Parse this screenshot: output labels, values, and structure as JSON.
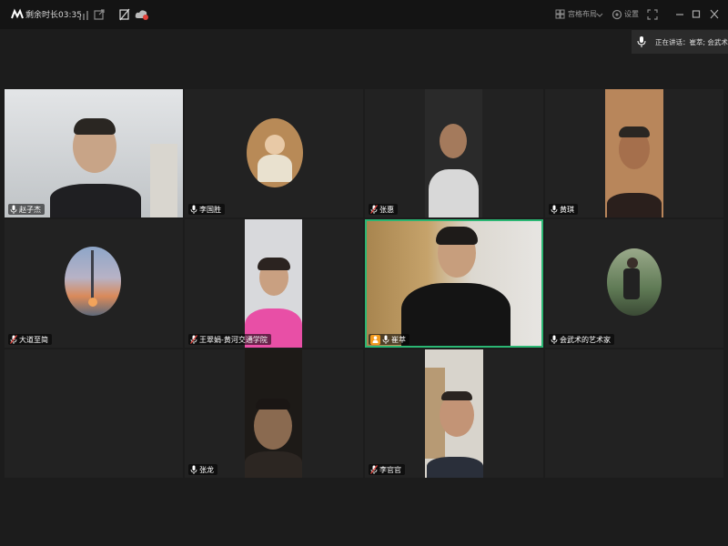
{
  "topbar": {
    "timer": "剩余时长03:35",
    "layout_label": "宫格布局",
    "settings_label": "设置"
  },
  "speaking": {
    "text": "正在讲话：崔萃; 会武术"
  },
  "participants": [
    {
      "name": "赵子杰",
      "mic": "on"
    },
    {
      "name": "李国胜",
      "mic": "on"
    },
    {
      "name": "张惠",
      "mic": "muted"
    },
    {
      "name": "黄琪",
      "mic": "on"
    },
    {
      "name": "大道至简",
      "mic": "muted"
    },
    {
      "name": "王翠娟-黄河交通学院",
      "mic": "muted"
    },
    {
      "name": "崔萃",
      "mic": "on",
      "host": true,
      "active_speaker": true
    },
    {
      "name": "会武术的艺术家",
      "mic": "on"
    },
    {
      "name": "张龙",
      "mic": "on"
    },
    {
      "name": "李官官",
      "mic": "muted"
    }
  ],
  "colors": {
    "active_border": "#2bb673",
    "host_badge": "#f39a1e",
    "muted_mic": "#e0413a"
  }
}
